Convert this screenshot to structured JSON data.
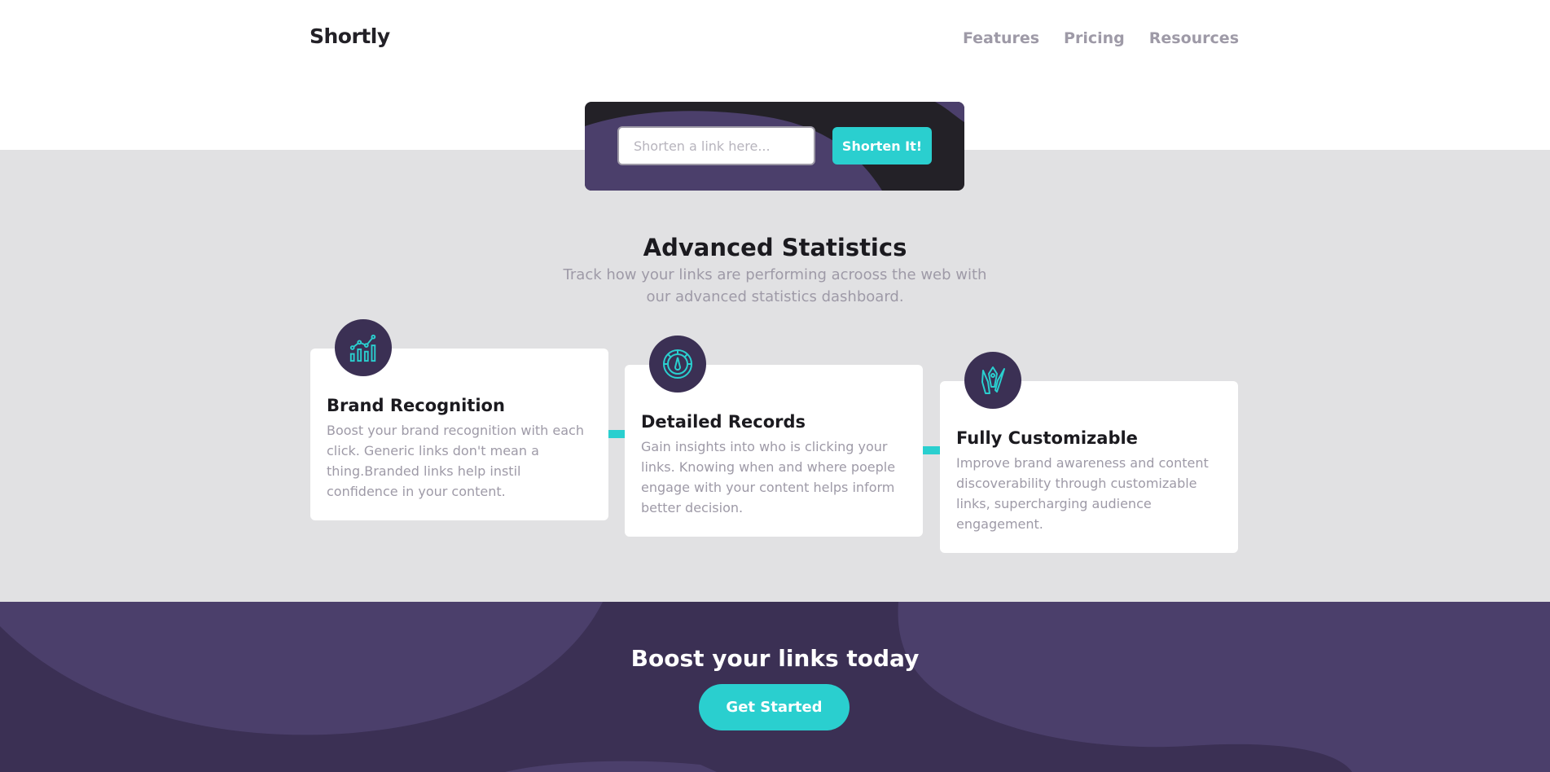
{
  "header": {
    "logo": "Shortly",
    "nav": [
      "Features",
      "Pricing",
      "Resources"
    ]
  },
  "shorten": {
    "placeholder": "Shorten a link here...",
    "button_label": "Shorten It!"
  },
  "stats": {
    "title": "Advanced Statistics",
    "subtitle": "Track how your links are performing acrooss the web with our advanced statistics dashboard.",
    "cards": [
      {
        "title": "Brand Recognition",
        "description": "Boost your brand recognition with each click. Generic links don't mean a thing.Branded links help instil confidence in your content.",
        "icon": "bar-chart-icon"
      },
      {
        "title": "Detailed Records",
        "description": "Gain insights into who is clicking your links. Knowing when and where poeple engage with your content helps inform better decision.",
        "icon": "gauge-icon"
      },
      {
        "title": "Fully Customizable",
        "description": "Improve brand awareness and content discoverability through customizable links, supercharging audience engagement.",
        "icon": "pen-brush-icon"
      }
    ]
  },
  "boost": {
    "title": "Boost your links today",
    "button_label": "Get Started"
  },
  "colors": {
    "cyan": "#2acfcf",
    "dark_violet": "#3b3054",
    "very_dark": "#232127",
    "gray": "#9e9aa7",
    "light_gray_bg": "#e1e1e3"
  }
}
